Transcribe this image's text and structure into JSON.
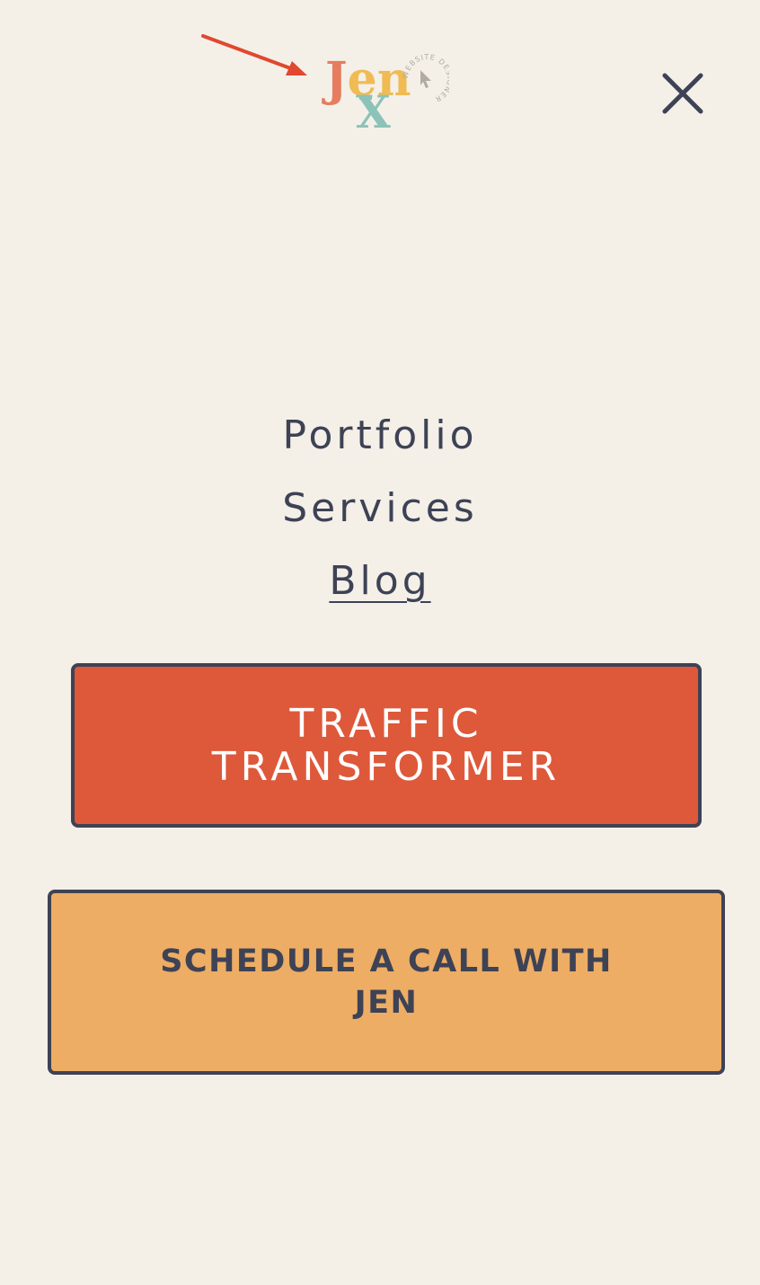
{
  "header": {
    "logo": {
      "brand_text_top": "Jen",
      "brand_text_bottom": "-X",
      "badge_text": "WEBSITE DESIGNER",
      "colors": {
        "j": "#e57d5e",
        "en": "#efbb52",
        "x": "#8cc3b8",
        "dash": "#8cc3b8",
        "badge": "#b3aaa3"
      }
    },
    "annotation_arrow": {
      "color": "#e0482f"
    },
    "close_icon": "close-icon"
  },
  "nav": {
    "items": [
      {
        "label": "Portfolio",
        "active": false
      },
      {
        "label": "Services",
        "active": false
      },
      {
        "label": "Blog",
        "active": true
      }
    ]
  },
  "cta": {
    "traffic_label": "TRAFFIC TRANSFORMER",
    "schedule_label": "SCHEDULE A CALL WITH JEN"
  },
  "colors": {
    "background": "#f4f0e8",
    "text": "#3e4255",
    "traffic_button": "#de583a",
    "schedule_button": "#edad64"
  }
}
